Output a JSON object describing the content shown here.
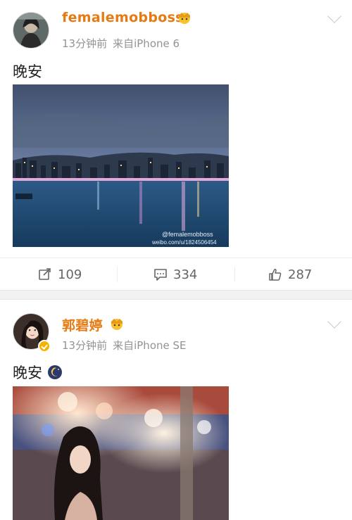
{
  "posts": [
    {
      "username": "femalemobboss",
      "time": "13分钟前",
      "source": "来自iPhone 6",
      "text": "晚安",
      "watermark_handle": "@femalemobboss",
      "watermark_url": "weibo.com/u/1824506454",
      "repost_count": "109",
      "comment_count": "334",
      "like_count": "287"
    },
    {
      "username": "郭碧婷",
      "time": "13分钟前",
      "source": "来自iPhone SE",
      "text": "晚安"
    }
  ],
  "colors": {
    "username": "#e87a14",
    "meta": "#939393",
    "badge": "#f5b300",
    "separator_band": "#f2f2f2"
  },
  "icons": [
    "crown-emoji-icon",
    "chevron-down-icon",
    "repost-icon",
    "comment-icon",
    "like-icon",
    "verified-badge-icon",
    "moon-emoji-icon"
  ]
}
